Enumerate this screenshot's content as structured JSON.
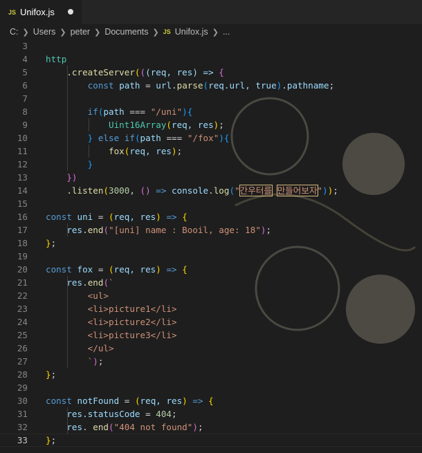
{
  "tab": {
    "icon": "JS",
    "title": "Unifox.js",
    "dirty_icon": "unsaved-dot"
  },
  "breadcrumb": {
    "parts": [
      "C:",
      "Users",
      "peter",
      "Documents"
    ],
    "file_icon": "JS",
    "file": "Unifox.js",
    "more": "..."
  },
  "editor": {
    "active_line": "33",
    "line_numbers": [
      "3",
      "4",
      "5",
      "6",
      "7",
      "8",
      "9",
      "10",
      "11",
      "12",
      "13",
      "14",
      "15",
      "16",
      "17",
      "18",
      "19",
      "20",
      "21",
      "22",
      "23",
      "24",
      "25",
      "26",
      "27",
      "28",
      "29",
      "30",
      "31",
      "32",
      "33"
    ]
  },
  "code": {
    "l4": "http",
    "l5_method": ".createServer",
    "l5_args": "(req, res) =>",
    "l6_kw": "const",
    "l6_var": "path",
    "l6_rest1": "url",
    "l6_fn": "parse",
    "l6_args": "req.url, true",
    "l6_prop": "pathname",
    "l8_kw": "if",
    "l8_var": "path",
    "l8_str": "\"/uni\"",
    "l9_fn": "Uint16Array",
    "l9_args": "req, res",
    "l10_kw1": "else",
    "l10_kw2": "if",
    "l10_var": "path",
    "l10_str": "\"/fox\"",
    "l11_fn": "fox",
    "l11_args": "req, res",
    "l14_method": ".listen",
    "l14_num": "3000",
    "l14_obj": "console",
    "l14_fn": "log",
    "l14_str_a": "\"",
    "l14_str_b": "간우터를",
    "l14_str_c": "만들어보자",
    "l14_str_d": "\"",
    "l16_kw": "const",
    "l16_name": "uni",
    "l16_args": "req, res",
    "l17_obj": "res",
    "l17_fn": "end",
    "l17_str": "\"[uni] name : Booil, age: 18\"",
    "l20_kw": "const",
    "l20_name": "fox",
    "l20_args": "req, res",
    "l21_obj": "res",
    "l21_fn": "end",
    "l21_tick": "`",
    "l22": "<ul>",
    "l23": "<li>picture1</li>",
    "l24": "<li>picture2</li>",
    "l25": "<li>picture3</li>",
    "l26": "</ul>",
    "l27": "`",
    "l30_kw": "const",
    "l30_name": "notFound",
    "l30_args": "req, res",
    "l31_obj": "res",
    "l31_prop": "statusCode",
    "l31_num": "404",
    "l32_obj": "res",
    "l32_fn": "end",
    "l32_str": "\"404 not found\""
  }
}
